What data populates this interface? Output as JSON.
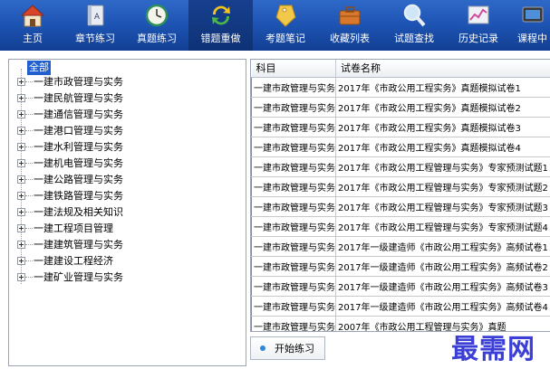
{
  "toolbar": {
    "items": [
      {
        "label": "主页",
        "icon": "home-icon"
      },
      {
        "label": "章节练习",
        "icon": "book-icon"
      },
      {
        "label": "真题练习",
        "icon": "clock-icon"
      },
      {
        "label": "错题重做",
        "icon": "refresh-icon"
      },
      {
        "label": "考题笔记",
        "icon": "tag-icon"
      },
      {
        "label": "收藏列表",
        "icon": "briefcase-icon"
      },
      {
        "label": "试题查找",
        "icon": "magnifier-icon"
      },
      {
        "label": "历史记录",
        "icon": "chart-icon"
      },
      {
        "label": "课程中",
        "icon": "tv-icon"
      }
    ],
    "active_index": 3
  },
  "tree": {
    "root": "全部",
    "items": [
      "一建市政管理与实务",
      "一建民航管理与实务",
      "一建通信管理与实务",
      "一建港口管理与实务",
      "一建水利管理与实务",
      "一建机电管理与实务",
      "一建公路管理与实务",
      "一建铁路管理与实务",
      "一建法规及相关知识",
      "一建工程项目管理",
      "一建建筑管理与实务",
      "一建建设工程经济",
      "一建矿业管理与实务"
    ]
  },
  "table": {
    "headers": [
      "科目",
      "试卷名称"
    ],
    "rows": [
      [
        "一建市政管理与实务",
        "2017年《市政公用工程实务》真题模拟试卷1"
      ],
      [
        "一建市政管理与实务",
        "2017年《市政公用工程实务》真题模拟试卷2"
      ],
      [
        "一建市政管理与实务",
        "2017年《市政公用工程实务》真题模拟试卷3"
      ],
      [
        "一建市政管理与实务",
        "2017年《市政公用工程实务》真题模拟试卷4"
      ],
      [
        "一建市政管理与实务",
        "2017年《市政公用工程管理与实务》专家预测试题1"
      ],
      [
        "一建市政管理与实务",
        "2017年《市政公用工程管理与实务》专家预测试题2"
      ],
      [
        "一建市政管理与实务",
        "2017年《市政公用工程管理与实务》专家预测试题3"
      ],
      [
        "一建市政管理与实务",
        "2017年《市政公用工程管理与实务》专家预测试题4"
      ],
      [
        "一建市政管理与实务",
        "2017年一级建造师《市政公用工程实务》高频试卷1"
      ],
      [
        "一建市政管理与实务",
        "2017年一级建造师《市政公用工程实务》高频试卷2"
      ],
      [
        "一建市政管理与实务",
        "2017年一级建造师《市政公用工程实务》高频试卷3"
      ],
      [
        "一建市政管理与实务",
        "2017年一级建造师《市政公用工程实务》高频试卷4"
      ],
      [
        "一建市政管理与实务",
        "2007年《市政公用工程管理与实务》真题"
      ]
    ]
  },
  "start_button": {
    "label": "开始练习"
  },
  "watermark": {
    "text": "最需网"
  }
}
